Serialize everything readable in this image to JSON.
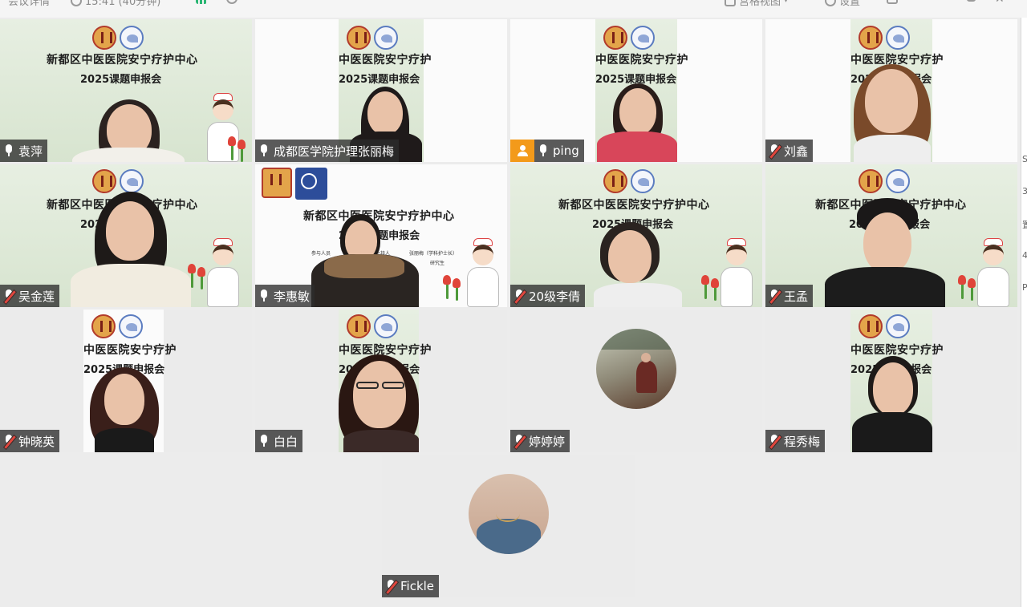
{
  "toolbar": {
    "meeting_details": "会议详情",
    "duration": "15:41 (40分钟)",
    "layout": "宫格视图",
    "settings": "设置"
  },
  "banner": {
    "title": "新都区中医医院安宁疗护中心",
    "title_cut": "中医医院安宁疗护",
    "title_cut2": "新都区中医医院安宁疗护中心",
    "subtitle": "2025课题申报会",
    "subtitle_cut": "2025课题申报会",
    "tiny_1": "参与人员",
    "tiny_2": "主持人",
    "tiny_3": "张丽梅（学科护士长）",
    "tiny_4": "研究生"
  },
  "participants": [
    {
      "name": "袁萍",
      "mic": "on"
    },
    {
      "name": "成都医学院护理张丽梅",
      "mic": "on",
      "speaking": true
    },
    {
      "name": "ping",
      "mic": "on",
      "host": true
    },
    {
      "name": "刘鑫",
      "mic": "muted"
    },
    {
      "name": "吴金莲",
      "mic": "muted"
    },
    {
      "name": "李惠敏",
      "mic": "on"
    },
    {
      "name": "20级李倩",
      "mic": "muted"
    },
    {
      "name": "王孟",
      "mic": "muted"
    },
    {
      "name": "钟晓英",
      "mic": "muted"
    },
    {
      "name": "白白",
      "mic": "on"
    },
    {
      "name": "婷婷婷",
      "mic": "muted"
    },
    {
      "name": "程秀梅",
      "mic": "muted"
    },
    {
      "name": "Fickle",
      "mic": "muted"
    }
  ],
  "colors": {
    "active_border": "#23c27a",
    "host_badge": "#f39a1a",
    "muted_slash": "#e0463d"
  }
}
